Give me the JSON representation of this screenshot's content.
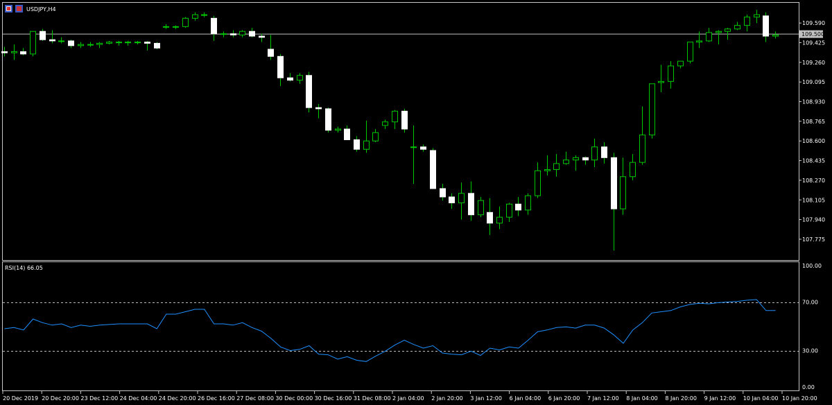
{
  "symbol_label": "USDJPY,H4",
  "colors": {
    "background": "#000000",
    "grid_frame": "#c8c8c8",
    "bull_wick": "#00c800",
    "bear_body": "#ffffff",
    "rsi_line": "#1e90ff",
    "bid_line": "#c0c0c0",
    "bid_tag_bg": "#c0c0c0",
    "bid_tag_text": "#000000"
  },
  "chart_data": [
    {
      "type": "candlestick",
      "title": "USDJPY,H4",
      "ylim": [
        107.6,
        109.76
      ],
      "y_ticks": [
        "109.590",
        "109.425",
        "109.260",
        "109.095",
        "108.930",
        "108.765",
        "108.600",
        "108.435",
        "108.270",
        "108.105",
        "107.940",
        "107.775"
      ],
      "bid_price": "109.500",
      "x_ticks": [
        "20 Dec 2019",
        "20 Dec 20:00",
        "23 Dec 12:00",
        "24 Dec 04:00",
        "24 Dec 20:00",
        "26 Dec 16:00",
        "27 Dec 08:00",
        "30 Dec 00:00",
        "30 Dec 16:00",
        "31 Dec 08:00",
        "2 Jan 04:00",
        "2 Jan 20:00",
        "3 Jan 12:00",
        "6 Jan 04:00",
        "6 Jan 20:00",
        "7 Jan 12:00",
        "8 Jan 04:00",
        "8 Jan 20:00",
        "9 Jan 12:00",
        "10 Jan 04:00",
        "10 Jan 20:00"
      ],
      "candles": [
        [
          109.35,
          109.39,
          109.31,
          109.34
        ],
        [
          109.34,
          109.41,
          109.28,
          109.35
        ],
        [
          109.35,
          109.38,
          109.32,
          109.33
        ],
        [
          109.33,
          109.52,
          109.31,
          109.52
        ],
        [
          109.52,
          109.54,
          109.44,
          109.45
        ],
        [
          109.45,
          109.53,
          109.42,
          109.44
        ],
        [
          109.44,
          109.47,
          109.42,
          109.44
        ],
        [
          109.44,
          109.45,
          109.38,
          109.4
        ],
        [
          109.4,
          109.43,
          109.38,
          109.41
        ],
        [
          109.41,
          109.43,
          109.39,
          109.41
        ],
        [
          109.41,
          109.43,
          109.38,
          109.42
        ],
        [
          109.42,
          109.44,
          109.41,
          109.43
        ],
        [
          109.43,
          109.44,
          109.4,
          109.43
        ],
        [
          109.43,
          109.44,
          109.4,
          109.43
        ],
        [
          109.43,
          109.44,
          109.41,
          109.43
        ],
        [
          109.43,
          109.44,
          109.36,
          109.42
        ],
        [
          109.42,
          109.43,
          109.37,
          109.38
        ],
        [
          109.56,
          109.58,
          109.54,
          109.56
        ],
        [
          109.56,
          109.57,
          109.54,
          109.56
        ],
        [
          109.56,
          109.64,
          109.55,
          109.63
        ],
        [
          109.63,
          109.68,
          109.61,
          109.66
        ],
        [
          109.66,
          109.68,
          109.64,
          109.66
        ],
        [
          109.63,
          109.65,
          109.44,
          109.5
        ],
        [
          109.5,
          109.52,
          109.47,
          109.5
        ],
        [
          109.5,
          109.53,
          109.47,
          109.49
        ],
        [
          109.49,
          109.53,
          109.47,
          109.52
        ],
        [
          109.52,
          109.55,
          109.47,
          109.48
        ],
        [
          109.48,
          109.5,
          109.43,
          109.47
        ],
        [
          109.37,
          109.49,
          109.28,
          109.31
        ],
        [
          109.31,
          109.33,
          109.06,
          109.13
        ],
        [
          109.13,
          109.17,
          109.1,
          109.11
        ],
        [
          109.11,
          109.17,
          109.08,
          109.15
        ],
        [
          109.15,
          109.18,
          108.84,
          108.88
        ],
        [
          108.88,
          108.91,
          108.79,
          108.87
        ],
        [
          108.87,
          108.88,
          108.67,
          108.69
        ],
        [
          108.69,
          108.72,
          108.67,
          108.7
        ],
        [
          108.7,
          108.73,
          108.61,
          108.61
        ],
        [
          108.61,
          108.64,
          108.51,
          108.53
        ],
        [
          108.53,
          108.77,
          108.5,
          108.6
        ],
        [
          108.6,
          108.7,
          108.59,
          108.67
        ],
        [
          108.73,
          108.78,
          108.7,
          108.76
        ],
        [
          108.76,
          108.86,
          108.7,
          108.85
        ],
        [
          108.85,
          108.87,
          108.67,
          108.7
        ],
        [
          108.55,
          108.73,
          108.24,
          108.55
        ],
        [
          108.55,
          108.57,
          108.51,
          108.53
        ],
        [
          108.52,
          108.54,
          108.27,
          108.2
        ],
        [
          108.2,
          108.24,
          108.1,
          108.13
        ],
        [
          108.13,
          108.16,
          108.03,
          108.08
        ],
        [
          108.08,
          108.25,
          107.94,
          108.16
        ],
        [
          108.16,
          108.26,
          107.93,
          107.98
        ],
        [
          107.98,
          108.13,
          107.96,
          108.1
        ],
        [
          108.0,
          108.12,
          107.81,
          107.91
        ],
        [
          107.91,
          108.05,
          107.86,
          107.96
        ],
        [
          107.96,
          108.08,
          107.92,
          108.07
        ],
        [
          108.07,
          108.13,
          107.97,
          108.02
        ],
        [
          108.02,
          108.16,
          107.98,
          108.14
        ],
        [
          108.14,
          108.42,
          108.12,
          108.35
        ],
        [
          108.35,
          108.48,
          108.31,
          108.36
        ],
        [
          108.36,
          108.49,
          108.3,
          108.41
        ],
        [
          108.41,
          108.51,
          108.4,
          108.44
        ],
        [
          108.44,
          108.48,
          108.35,
          108.46
        ],
        [
          108.46,
          108.47,
          108.4,
          108.44
        ],
        [
          108.44,
          108.62,
          108.38,
          108.55
        ],
        [
          108.55,
          108.59,
          108.41,
          108.46
        ],
        [
          108.46,
          108.5,
          107.68,
          108.03
        ],
        [
          108.03,
          108.46,
          107.98,
          108.3
        ],
        [
          108.3,
          108.49,
          108.27,
          108.42
        ],
        [
          108.42,
          108.89,
          108.4,
          108.65
        ],
        [
          108.65,
          109.08,
          108.62,
          109.08
        ],
        [
          109.09,
          109.24,
          109.01,
          109.1
        ],
        [
          109.1,
          109.27,
          109.04,
          109.23
        ],
        [
          109.23,
          109.27,
          109.21,
          109.27
        ],
        [
          109.27,
          109.43,
          109.25,
          109.43
        ],
        [
          109.43,
          109.52,
          109.38,
          109.44
        ],
        [
          109.44,
          109.55,
          109.43,
          109.51
        ],
        [
          109.51,
          109.53,
          109.41,
          109.52
        ],
        [
          109.52,
          109.55,
          109.45,
          109.54
        ],
        [
          109.54,
          109.6,
          109.53,
          109.57
        ],
        [
          109.57,
          109.66,
          109.52,
          109.64
        ],
        [
          109.64,
          109.7,
          109.59,
          109.66
        ],
        [
          109.65,
          109.68,
          109.43,
          109.48
        ],
        [
          109.48,
          109.52,
          109.46,
          109.49
        ]
      ]
    },
    {
      "type": "line",
      "title": "RSI(14) 66.05",
      "ylim": [
        0,
        100
      ],
      "y_ticks": [
        "100.00",
        "70.00",
        "30.00",
        "0.00"
      ],
      "levels": [
        70,
        30
      ],
      "series": [
        {
          "values": [
            48,
            49,
            47,
            56,
            53,
            51,
            52,
            49,
            51,
            50,
            51,
            51.5,
            52,
            52,
            52,
            52,
            48,
            60,
            60,
            62,
            64,
            64,
            52,
            52,
            51,
            53,
            49,
            46,
            40,
            33,
            30,
            31,
            34,
            27,
            26.5,
            23,
            25,
            22,
            21,
            25.5,
            29.5,
            34.5,
            38.5,
            35,
            32,
            34,
            28,
            27,
            26.5,
            29.5,
            26,
            32,
            30.5,
            33,
            32,
            38.5,
            45.5,
            47,
            49,
            49.5,
            48.5,
            51,
            51,
            48.5,
            43,
            36,
            47,
            53,
            61,
            62,
            63,
            66,
            68,
            69,
            68.5,
            69.5,
            70,
            70.5,
            71.5,
            72,
            63,
            63
          ]
        }
      ]
    }
  ]
}
